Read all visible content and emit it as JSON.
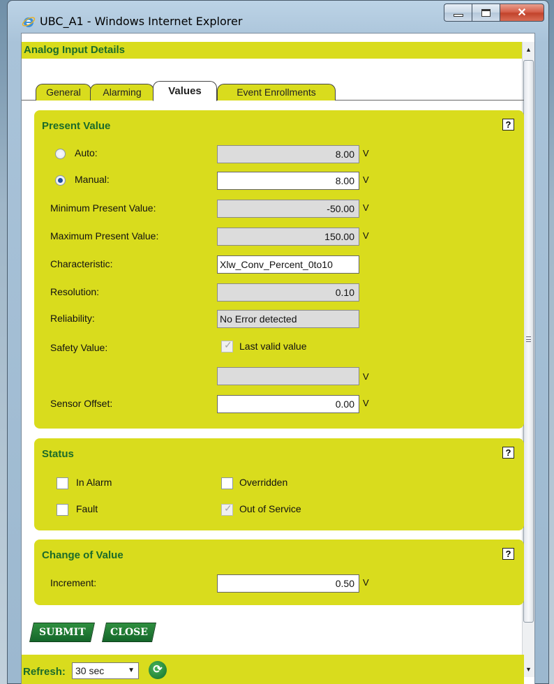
{
  "window": {
    "title": "UBC_A1 - Windows Internet Explorer"
  },
  "header": {
    "title": "Analog Input Details"
  },
  "tabs": [
    {
      "label": "General"
    },
    {
      "label": "Alarming"
    },
    {
      "label": "Values",
      "active": true
    },
    {
      "label": "Event Enrollments"
    }
  ],
  "present_value": {
    "title": "Present Value",
    "help": "?",
    "auto": {
      "label": "Auto:",
      "value": "8.00",
      "unit": "V",
      "selected": false
    },
    "manual": {
      "label": "Manual:",
      "value": "8.00",
      "unit": "V",
      "selected": true
    },
    "min": {
      "label": "Minimum Present Value:",
      "value": "-50.00",
      "unit": "V"
    },
    "max": {
      "label": "Maximum Present Value:",
      "value": "150.00",
      "unit": "V"
    },
    "characteristic": {
      "label": "Characteristic:",
      "value": "Xlw_Conv_Percent_0to10"
    },
    "resolution": {
      "label": "Resolution:",
      "value": "0.10"
    },
    "reliability": {
      "label": "Reliability:",
      "value": "No Error detected"
    },
    "safety": {
      "label": "Safety Value:",
      "checkbox_label": "Last valid value",
      "checked": true,
      "value": "",
      "unit": "V"
    },
    "sensor_offset": {
      "label": "Sensor Offset:",
      "value": "0.00",
      "unit": "V"
    }
  },
  "status": {
    "title": "Status",
    "help": "?",
    "in_alarm": {
      "label": "In Alarm",
      "checked": false
    },
    "overridden": {
      "label": "Overridden",
      "checked": false
    },
    "fault": {
      "label": "Fault",
      "checked": false
    },
    "out_of_service": {
      "label": "Out of Service",
      "checked": true
    }
  },
  "cov": {
    "title": "Change of Value",
    "help": "?",
    "increment": {
      "label": "Increment:",
      "value": "0.50",
      "unit": "V"
    }
  },
  "buttons": {
    "submit": "SUBMIT",
    "close": "CLOSE"
  },
  "refresh": {
    "label": "Refresh:",
    "value": "30 sec"
  },
  "colors": {
    "accent": "#d9dc1d",
    "heading": "#1b6b2a",
    "button": "#1e7a32"
  }
}
